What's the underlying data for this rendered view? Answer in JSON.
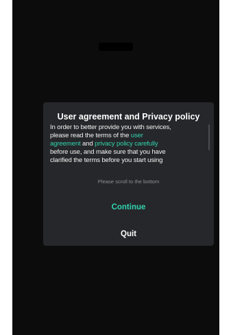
{
  "dialog": {
    "title": "User agreement and Privacy policy",
    "terms": {
      "line1": "In order to better provide you with services,",
      "line2": "please read the terms of the ",
      "user_agreement_link_1": "user",
      "user_agreement_link_2": "agreement",
      "and_1": " and ",
      "privacy_policy_link": "privacy policy carefully",
      "line4": "before use, and make sure that you have",
      "line5": "clarified the terms before you start using"
    },
    "scroll_hint": "Please scroll to the bottom",
    "continue_label": "Continue",
    "quit_label": "Quit"
  },
  "colors": {
    "background": "#0c0c0d",
    "dialog": "#26272a",
    "accent": "#30d3b0",
    "text": "#ffffff",
    "hint": "#8e8f92"
  }
}
